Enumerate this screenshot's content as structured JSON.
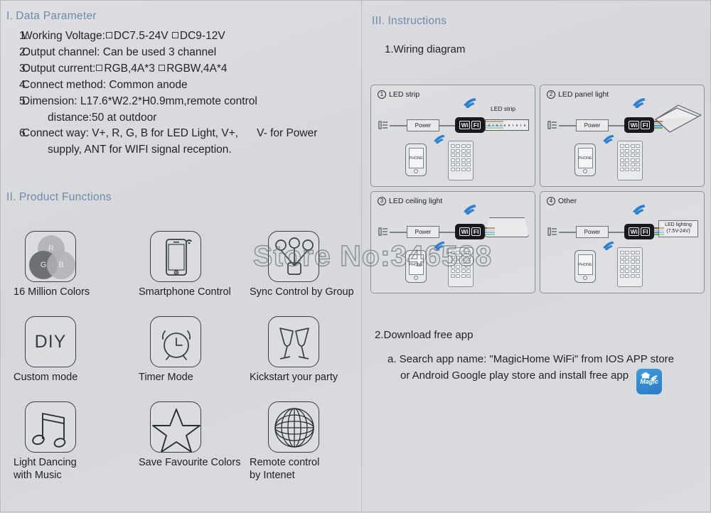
{
  "watermark": "Store No:346588",
  "sections": {
    "data_parameter": {
      "numeral": "I.",
      "title": "Data Parameter",
      "items": [
        {
          "num": "1.",
          "pre": "Working Voltage:",
          "opt1": "DC7.5-24V",
          "opt2": "DC9-12V"
        },
        {
          "num": "2.",
          "text": "Output channel: Can be used 3 channel"
        },
        {
          "num": "3.",
          "pre": "Output current:",
          "opt1": "RGB,4A*3",
          "opt2": "RGBW,4A*4"
        },
        {
          "num": "4.",
          "text": "Connect method: Common anode"
        },
        {
          "num": "5.",
          "text": "Dimension: L17.6*W2.2*H0.9mm,remote  control",
          "cont": "distance:50 at outdoor"
        },
        {
          "num": "6.",
          "text": "Connect way: V+, R, G, B for LED Light, V+,",
          "text2": "V- for Power",
          "cont": "supply, ANT for WIFI signal reception."
        }
      ]
    },
    "product_functions": {
      "numeral": "II.",
      "title": "Product Functions",
      "items": [
        {
          "icon": "rgb-circles-icon",
          "label": "16 Million Colors",
          "r": "R",
          "g": "G",
          "b": "B"
        },
        {
          "icon": "smartphone-wifi-icon",
          "label": "Smartphone Control"
        },
        {
          "icon": "group-sync-icon",
          "label": "Sync Control by Group"
        },
        {
          "icon": "diy-icon",
          "label": "Custom mode",
          "text": "DIY"
        },
        {
          "icon": "alarm-clock-icon",
          "label": "Timer Mode"
        },
        {
          "icon": "cheers-glasses-icon",
          "label": "Kickstart your party"
        },
        {
          "icon": "music-notes-icon",
          "label": "Light Dancing\nwith Music"
        },
        {
          "icon": "star-icon",
          "label": "Save Favourite Colors"
        },
        {
          "icon": "globe-icon",
          "label": "Remote control\nby Intenet"
        }
      ]
    },
    "instructions": {
      "numeral": "III.",
      "title": "Instructions",
      "wiring_heading": "1.Wiring diagram",
      "panels": [
        {
          "num": "1",
          "title": "LED strip",
          "power_label": "Power",
          "wifi_label_a": "Wi",
          "wifi_label_b": "FI",
          "phone_label": "PHONE",
          "load_label": "LED strip"
        },
        {
          "num": "2",
          "title": "LED panel light",
          "power_label": "Power",
          "wifi_label_a": "Wi",
          "wifi_label_b": "FI",
          "phone_label": "PHONE"
        },
        {
          "num": "3",
          "title": "LED ceiling light",
          "power_label": "Power",
          "wifi_label_a": "Wi",
          "wifi_label_b": "FI",
          "phone_label": "PHONE"
        },
        {
          "num": "4",
          "title": "Other",
          "power_label": "Power",
          "wifi_label_a": "Wi",
          "wifi_label_b": "FI",
          "phone_label": "PHONE",
          "load_label": "LED lighting\n(7.5V-24V)"
        }
      ],
      "download": {
        "heading": "2.Download free app",
        "line_a": "a. Search app name: \"MagicHome WiFi\" from IOS APP store",
        "line_b": "or Android Google play store and install free app",
        "app_icon_text": "Magic"
      }
    }
  },
  "colors": {
    "heading": "#6f8aa8",
    "body_text": "#22242a",
    "wifi_blue": "#2f7fd0",
    "app_blue": "#3f9bdc",
    "page_bg": "#d8dade"
  }
}
